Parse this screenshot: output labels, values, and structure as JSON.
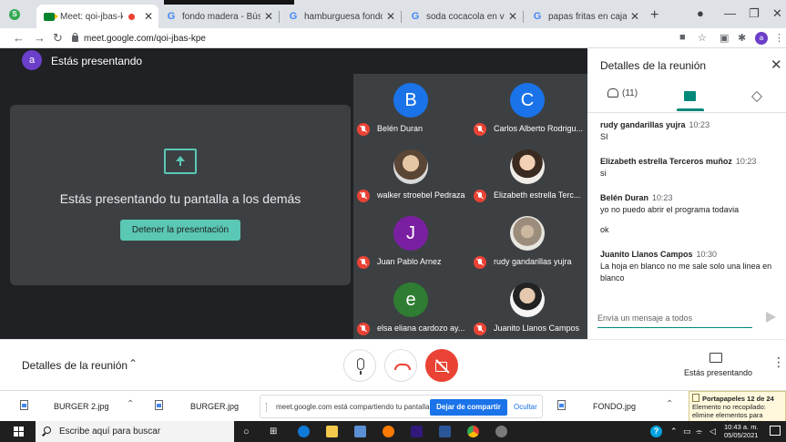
{
  "browser": {
    "app_badge": "S",
    "tabs": [
      {
        "title": "Meet: qoi-jbas-kpe",
        "active": true,
        "icon": "meet-icon"
      },
      {
        "title": "fondo madera - Búsqueda de",
        "active": false,
        "icon": "google-icon"
      },
      {
        "title": "hamburguesa fondo blanco",
        "active": false,
        "icon": "google-icon"
      },
      {
        "title": "soda cocacola en vaso - Bús",
        "active": false,
        "icon": "google-icon"
      },
      {
        "title": "papas fritas en caja - Búsqu",
        "active": false,
        "icon": "google-icon"
      }
    ],
    "google_glyph": "G",
    "new_tab": "+",
    "url": "meet.google.com/qoi-jbas-kpe",
    "profile_initial": "a"
  },
  "meet": {
    "presenter_initial": "a",
    "presenter_label": "Estás presentando",
    "present_message": "Estás presentando tu pantalla a los demás",
    "stop_button": "Detener la presentación",
    "participants": [
      {
        "name": "Belén Duran",
        "initial": "B",
        "color": "#1a73e8",
        "photo": ""
      },
      {
        "name": "Carlos Alberto Rodrigu...",
        "initial": "C",
        "color": "#1a73e8",
        "photo": ""
      },
      {
        "name": "walker stroebel Pedraza",
        "initial": "",
        "color": "",
        "photo": "photo"
      },
      {
        "name": "Elizabeth estrella Terc...",
        "initial": "",
        "color": "",
        "photo": "photo2"
      },
      {
        "name": "Juan Pablo Arnez",
        "initial": "J",
        "color": "#7b1fa2",
        "photo": ""
      },
      {
        "name": "rudy gandarillas yujra",
        "initial": "",
        "color": "",
        "photo": "photo3"
      },
      {
        "name": "elsa eliana cardozo ay...",
        "initial": "e",
        "color": "#2e7d32",
        "photo": ""
      },
      {
        "name": "Juanito Llanos Campos",
        "initial": "",
        "color": "",
        "photo": "photo4"
      }
    ]
  },
  "panel": {
    "title": "Detalles de la reunión",
    "people_count": "(11)",
    "messages": [
      {
        "who": "rudy gandarillas yujra",
        "time": "10:23",
        "lines": [
          "SI"
        ]
      },
      {
        "who": "Elizabeth estrella Terceros muñoz",
        "time": "10:23",
        "lines": [
          "si"
        ]
      },
      {
        "who": "Belén Duran",
        "time": "10:23",
        "lines": [
          "yo no puedo abrir el programa todavia",
          "ok"
        ]
      },
      {
        "who": "Juanito Llanos Campos",
        "time": "10:30",
        "lines": [
          "La hoja en blanco no me sale solo una linea en blanco"
        ]
      }
    ],
    "composer_placeholder": "Envía un mensaje a todos"
  },
  "bottombar": {
    "title": "Detalles de la reunión",
    "present_label": "Estás presentando"
  },
  "downloads": {
    "items": [
      "BURGER 2.jpg",
      "BURGER.jpg",
      "FONDO.jpg"
    ],
    "share_text": "meet.google.com está compartiendo tu pantalla.",
    "share_stop": "Dejar de compartir",
    "share_hide": "Ocultar",
    "clipboard_title": "Portapapeles 12 de 24",
    "clipboard_text": "Elemento no recopilado: elimine elementos para aumentar el espacio disponible"
  },
  "taskbar": {
    "search_placeholder": "Escribe aquí para buscar",
    "time": "10:43 a. m.",
    "date": "05/05/2021"
  }
}
